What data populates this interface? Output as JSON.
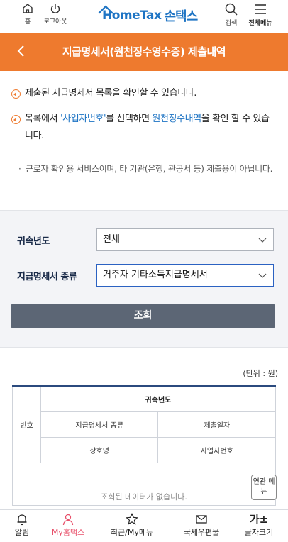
{
  "header": {
    "home_label": "홈",
    "logout_label": "로그아웃",
    "logo_en": "HomeTax",
    "logo_kr": "손택스",
    "search_label": "검색",
    "menu_label": "전체메뉴"
  },
  "titlebar": {
    "title": "지급명세서(원천징수영수증) 제출내역"
  },
  "info": {
    "bullet1": "제출된 지급명세서 목록을 확인할 수 있습니다.",
    "bullet2_pre": "목록에서 ",
    "bullet2_link1": "'사업자번호'",
    "bullet2_mid": "를 선택하면 ",
    "bullet2_link2": "원천징수내역",
    "bullet2_post": "을 확인 할 수 있습니다.",
    "note": "근로자 확인용 서비스이며, 타 기관(은행, 관공서 등) 제출용이 아닙니다."
  },
  "search": {
    "year_label": "귀속년도",
    "year_value": "전체",
    "type_label": "지급명세서 종류",
    "type_value": "거주자 기타소득지급명세서",
    "button_label": "조회"
  },
  "results": {
    "unit": "(단위 : 원)",
    "headers": {
      "no": "번호",
      "year": "귀속년도",
      "type": "지급명세서 종류",
      "submit_date": "제출일자",
      "company": "상호명",
      "biz_no": "사업자번호"
    },
    "empty_message": "조회된 데이터가 없습니다.",
    "related_menu": "연관 메뉴"
  },
  "tabbar": {
    "items": [
      "알림",
      "My홈택스",
      "최근/My메뉴",
      "국세우편물",
      "글자크기"
    ],
    "font_glyph": "가±"
  },
  "colors": {
    "accent": "#ee7a2e",
    "link": "#1e74c4",
    "button": "#5c6675",
    "active_tab": "#e8506a"
  }
}
